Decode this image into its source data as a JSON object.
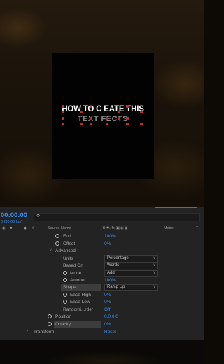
{
  "preview": {
    "title_line1": "HOW TO C EATE THIS",
    "title_line2": "TEXT  FECTS"
  },
  "timeline": {
    "timecode": "00:00:00",
    "fps": "0 (30.00 fps)",
    "columns": {
      "source_name": "Source Name",
      "mode": "Mode",
      "t": "T"
    },
    "props": {
      "end": {
        "label": "End",
        "value": "100%"
      },
      "offset": {
        "label": "Offset",
        "value": "0%"
      },
      "advanced": {
        "label": "Advanced"
      },
      "units": {
        "label": "Units",
        "value": "Percentage"
      },
      "based_on": {
        "label": "Based On",
        "value": "Words"
      },
      "mode": {
        "label": "Mode",
        "value": "Add"
      },
      "amount": {
        "label": "Amount",
        "value": "100%"
      },
      "shape": {
        "label": "Shape",
        "value": "Ramp Up"
      },
      "ease_high": {
        "label": "Ease High",
        "value": "0%"
      },
      "ease_low": {
        "label": "Ease Low",
        "value": "0%"
      },
      "randomize_order": {
        "label": "Randomi...rder",
        "value": "Off"
      },
      "position": {
        "label": "Position",
        "value": "0.0,0.0"
      },
      "opacity": {
        "label": "Opacity",
        "value": "0%"
      },
      "transform": {
        "label": "Transform",
        "value": "Reset"
      }
    }
  },
  "colors": {
    "value_blue": "#3b8df0",
    "panel_bg": "#232323",
    "highlight": "#3d3d3d",
    "red_mark": "#c42828"
  }
}
